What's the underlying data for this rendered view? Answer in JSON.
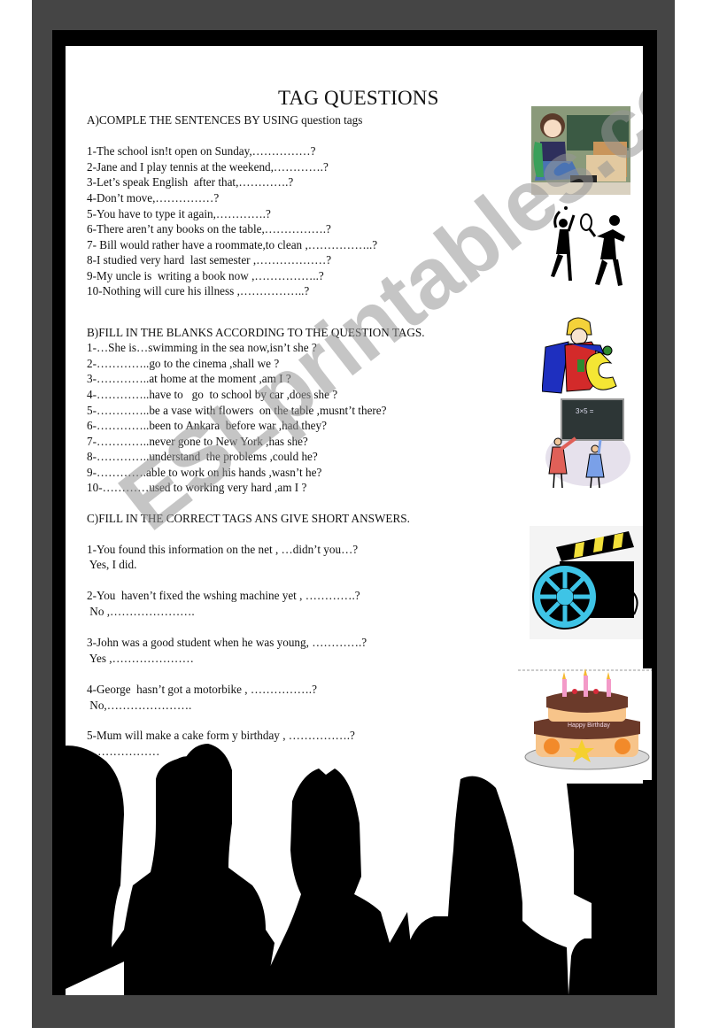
{
  "worksheet": {
    "title": "TAG QUESTIONS",
    "watermark": "ESLprintables.com",
    "section_a": {
      "heading": "A)COMPLE THE SENTENCES BY USING question tags",
      "items": [
        "1-The school isn!t open on Sunday,……………?",
        "2-Jane and I play tennis at the weekend,………….?",
        "3-Let’s speak English  after that,………….?",
        "4-Don’t move,……………?",
        "5-You have to type it again,………….?",
        "6-There aren’t any books on the table,…………….?",
        "7- Bill would rather have a roommate,to clean ,……………..?",
        "8-I studied very hard  last semester ,………………?",
        "9-My uncle is  writing a book now ,……………..?",
        "10-Nothing will cure his illness ,……………..?"
      ]
    },
    "section_b": {
      "heading": "B)FILL IN THE BLANKS ACCORDING TO THE QUESTION TAGS.",
      "items": [
        "1-…She is…swimming in the sea now,isn’t she ?",
        "2-…………..go to the cinema ,shall we ?",
        "3-…………..at home at the moment ,am I ?",
        "4-…………..have to   go  to school by car ,does she ?",
        "5-…………..be a vase with flowers  on the table ,musnt’t there?",
        "6-…………..been to Ankara  before war ,had they?",
        "7-…………..never gone to New York ,has she?",
        "8-…………..understand  the problems ,could he?",
        "9-………….able to work on his hands ,wasn’t he?",
        "10-…………used to working very hard ,am I ?"
      ]
    },
    "section_c": {
      "heading": "C)FILL IN THE CORRECT TAGS ANS GIVE SHORT ANSWERS.",
      "items": [
        {
          "question": "1-You found this information on the net , …didn’t you…?",
          "answer": " Yes, I did."
        },
        {
          "question": "2-You  haven’t fixed the wshing machine yet , ………….?",
          "answer": " No ,…………………."
        },
        {
          "question": "3-John was a good student when he was young, ………….?",
          "answer": " Yes ,…………………"
        },
        {
          "question": "4-George  hasn’t got a motorbike , …………….?",
          "answer": " No,…………………."
        },
        {
          "question": "5-Mum will make a cake form y birthday , …………….?",
          "answer": " ………………"
        }
      ]
    },
    "pictures": [
      {
        "name": "anime-schoolgirl-picture"
      },
      {
        "name": "tennis-players-picture"
      },
      {
        "name": "abc-clown-picture"
      },
      {
        "name": "teacher-blackboard-picture",
        "board_text": "3×5 ="
      },
      {
        "name": "film-clapper-reel-picture"
      },
      {
        "name": "birthday-cake-picture",
        "cake_text": "Happy Birthday"
      }
    ]
  }
}
